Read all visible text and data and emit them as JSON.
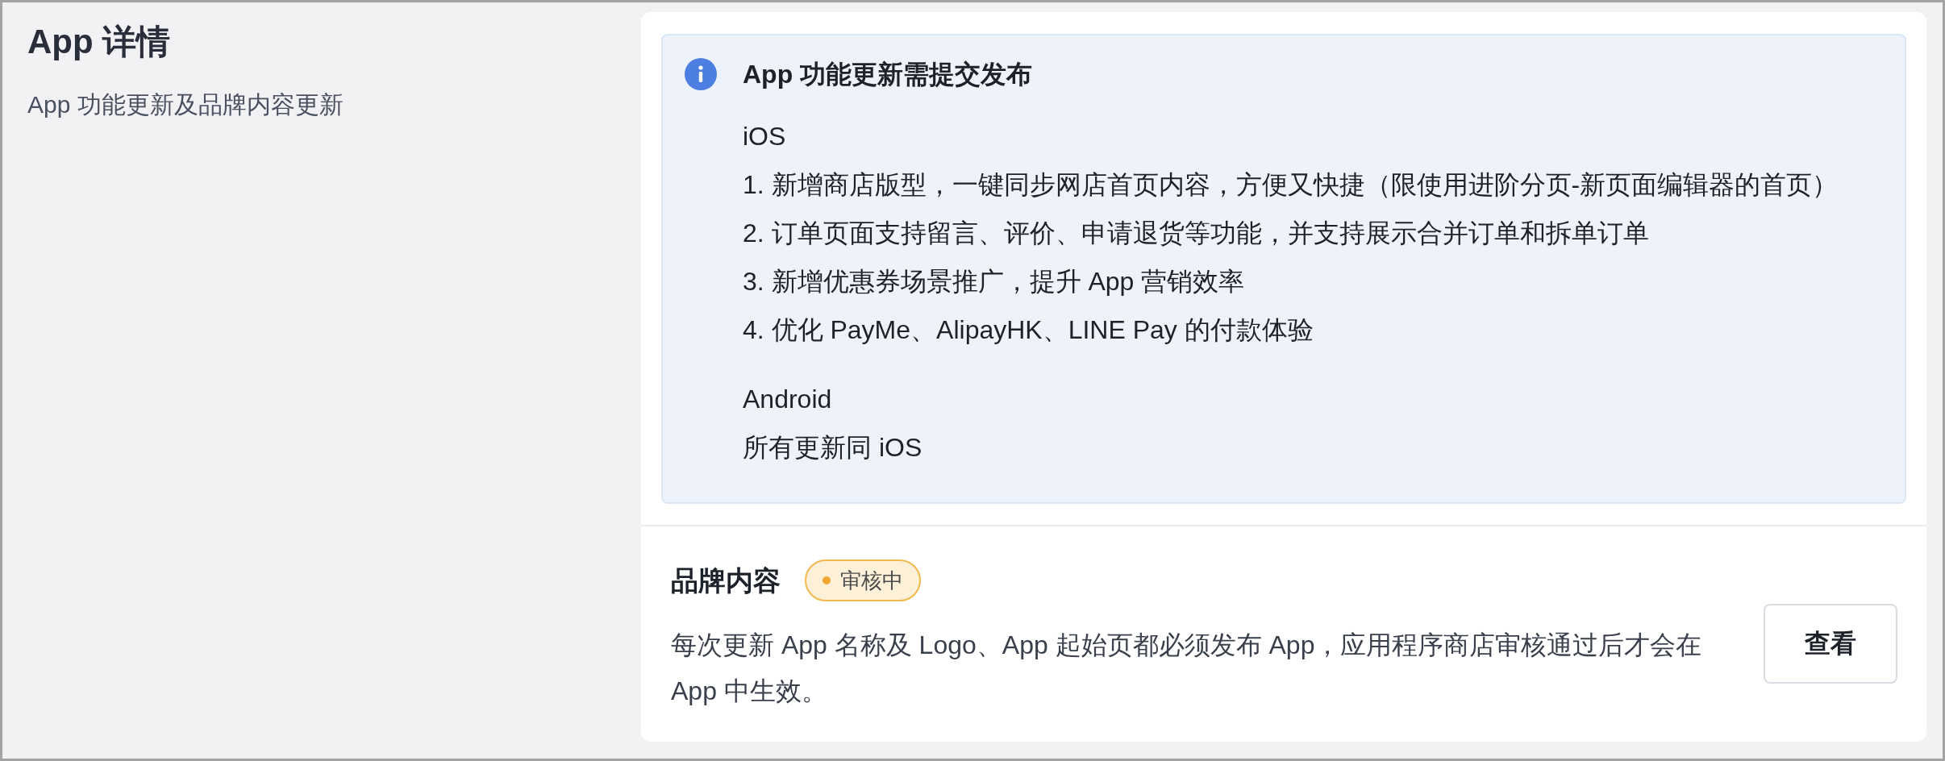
{
  "header": {
    "title": "App 详情",
    "subtitle": "App 功能更新及品牌内容更新"
  },
  "notice": {
    "title": "App 功能更新需提交发布",
    "sections": [
      {
        "platform": "iOS",
        "items": [
          "1. 新增商店版型，一键同步网店首页内容，方便又快捷（限使用进阶分页-新页面编辑器的首页）",
          "2. 订单页面支持留言、评价、申请退货等功能，并支持展示合并订单和拆单订单",
          "3. 新增优惠券场景推广，提升 App 营销效率",
          "4. 优化 PayMe、AlipayHK、LINE Pay 的付款体验"
        ]
      },
      {
        "platform": "Android",
        "items": [
          "所有更新同 iOS"
        ]
      }
    ]
  },
  "brand": {
    "title": "品牌内容",
    "status": {
      "label": "审核中",
      "kind": "pending"
    },
    "description": "每次更新 App 名称及 Logo、App 起始页都必须发布 App，应用程序商店审核通过后才会在 App 中生效。",
    "button": "查看"
  }
}
